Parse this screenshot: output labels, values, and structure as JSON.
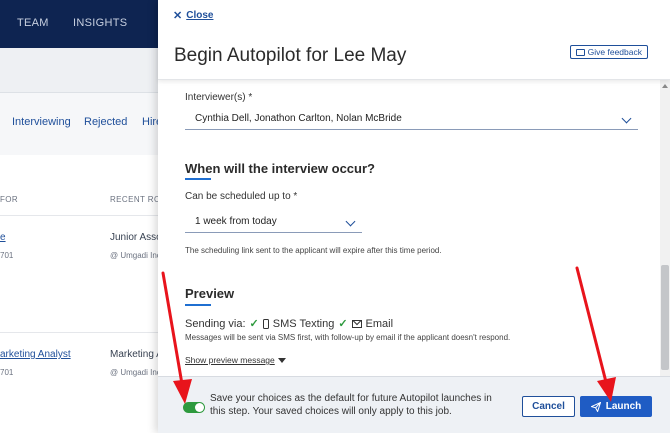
{
  "background": {
    "nav": [
      "TEAM",
      "INSIGHTS"
    ],
    "tabs": [
      "Interviewing",
      "Rejected",
      "Hire"
    ],
    "columns": [
      "FOR",
      "RECENT ROL"
    ],
    "rows": [
      {
        "link": "e",
        "sub": "701",
        "role": "Junior Asso",
        "company": "@ Umgadi Inc"
      },
      {
        "link": "arketing Analyst",
        "sub": "701",
        "role": "Marketing A",
        "company": "@ Umgadi Inc"
      }
    ]
  },
  "panel": {
    "close_label": "Close",
    "title": "Begin Autopilot for Lee May",
    "feedback_label": "Give feedback",
    "interviewers": {
      "label": "Interviewer(s) *",
      "value": "Cynthia Dell, Jonathon Carlton, Nolan McBride"
    },
    "when": {
      "title": "When will the interview occur?",
      "schedule_label": "Can be scheduled up to *",
      "schedule_value": "1 week from today",
      "help": "The scheduling link sent to the applicant will expire after this time period."
    },
    "preview": {
      "title": "Preview",
      "sending_via": "Sending via:",
      "sms": "SMS Texting",
      "email": "Email",
      "message": "Messages will be sent via SMS first, with follow-up by email if the applicant doesn't respond.",
      "show_preview": "Show preview message"
    },
    "footer": {
      "save_default_text": "Save your choices as the default for future Autopilot launches in this step. Your saved choices will only apply to this job.",
      "toggle_on": true,
      "cancel_label": "Cancel",
      "launch_label": "Launch"
    }
  },
  "colors": {
    "brand": "#1f5cc4",
    "nav_bg": "#0e2451",
    "toggle_on": "#2e9a3e",
    "annotation_arrow": "#e8141c"
  }
}
